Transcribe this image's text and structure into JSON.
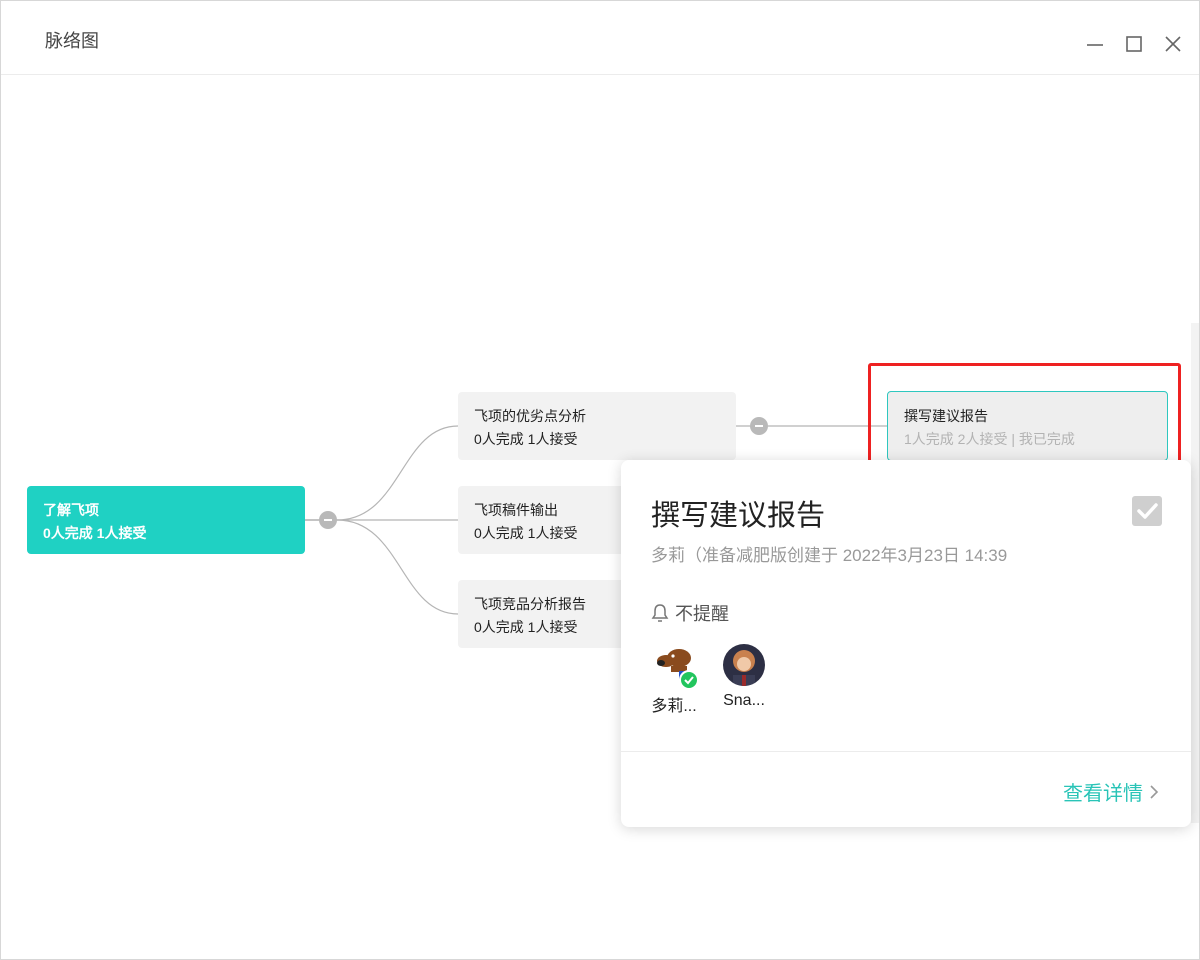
{
  "window": {
    "title": "脉络图"
  },
  "nodes": {
    "root": {
      "title": "了解飞项",
      "stats": "0人完成 1人接受"
    },
    "child1": {
      "title": "飞项的优劣点分析",
      "stats": "0人完成 1人接受"
    },
    "child2": {
      "title": "飞项稿件输出",
      "stats": "0人完成 1人接受"
    },
    "child3": {
      "title": "飞项竞品分析报告",
      "stats": "0人完成 1人接受"
    },
    "grandchild": {
      "title": "撰写建议报告",
      "stats": "1人完成 2人接受 | 我已完成"
    }
  },
  "popup": {
    "title": "撰写建议报告",
    "subtitle": "多莉（准备减肥版创建于 2022年3月23日 14:39",
    "remind": "不提醒",
    "members": [
      {
        "name": "多莉...",
        "icon": "dog-avatar",
        "completed": true
      },
      {
        "name": "Sna...",
        "icon": "person-avatar",
        "completed": false
      }
    ],
    "detail_link": "查看详情"
  },
  "colors": {
    "accent": "#1fd1c3",
    "link": "#29c4b7",
    "highlight": "#ee2121"
  }
}
